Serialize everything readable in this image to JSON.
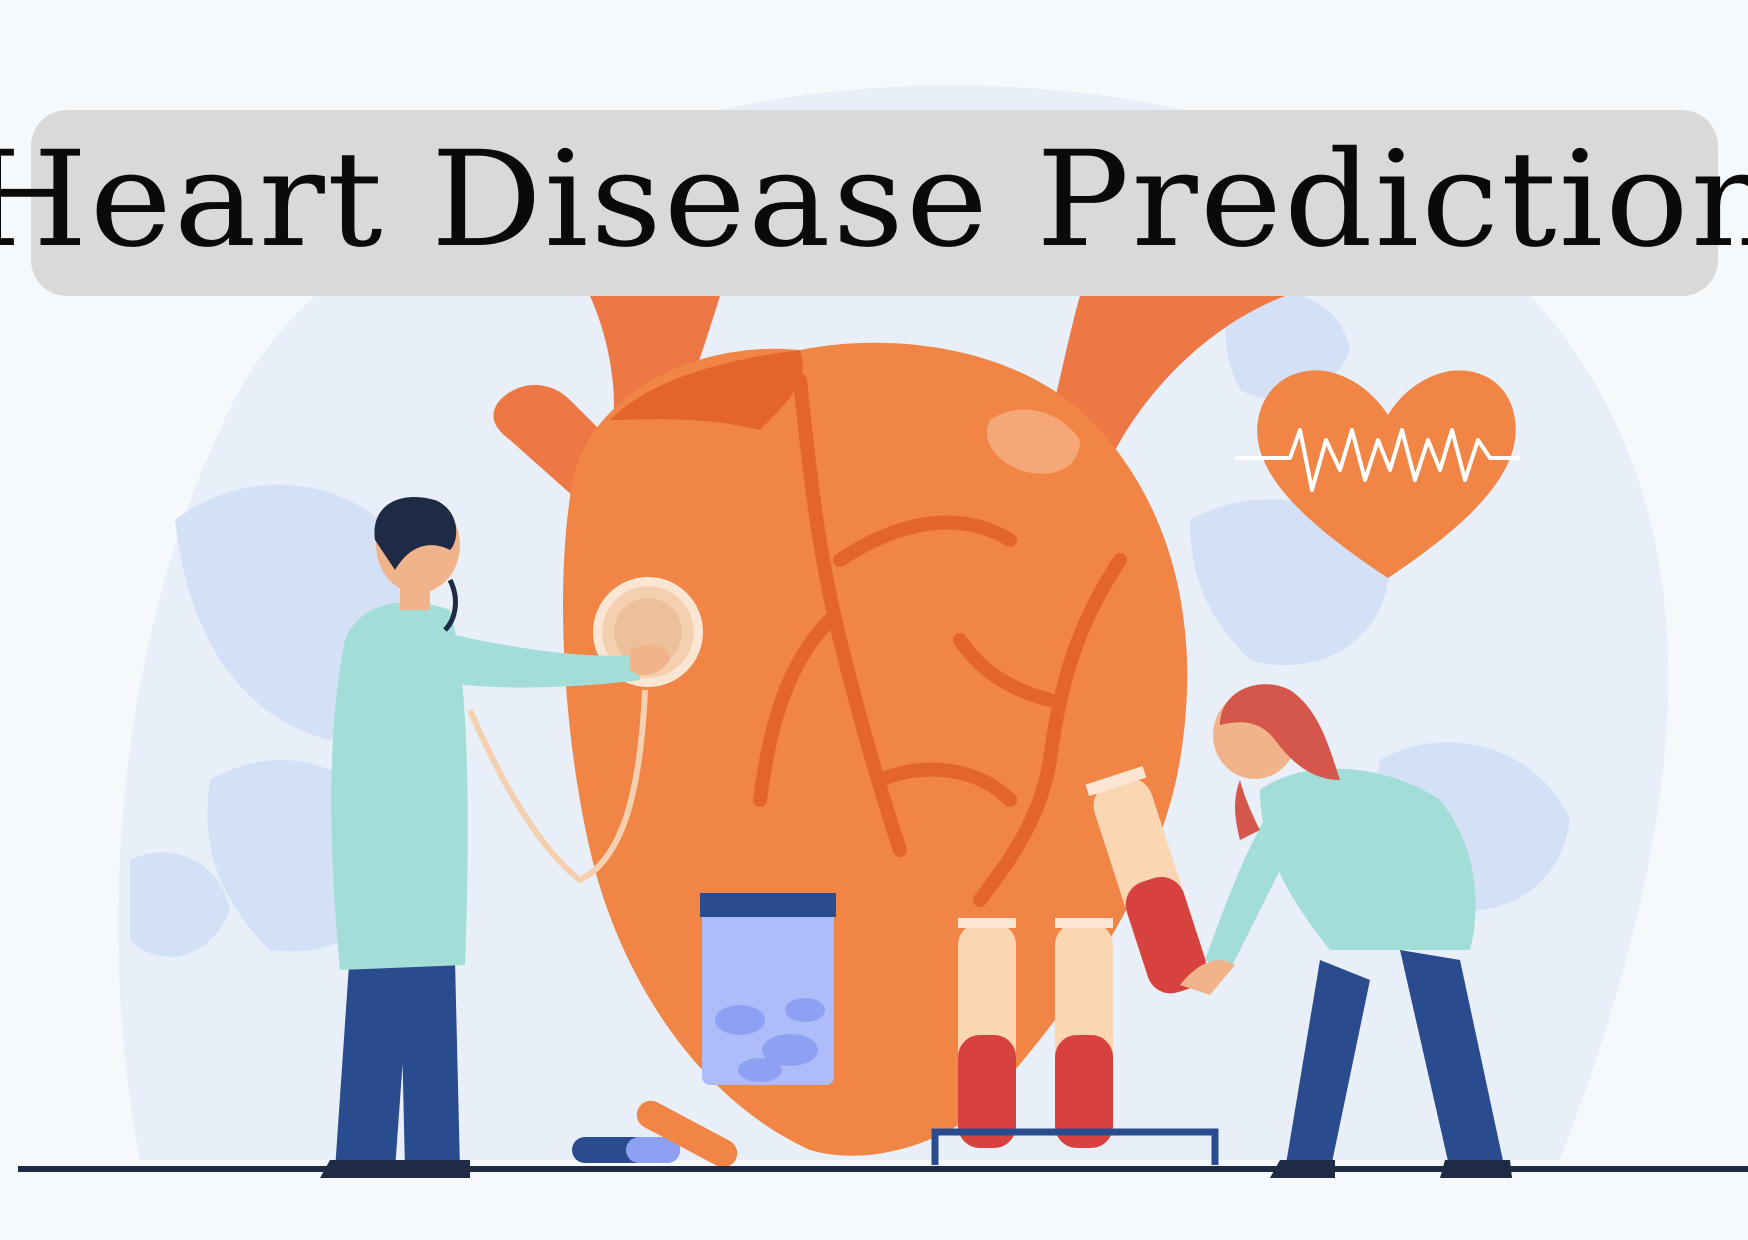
{
  "title": "Heart Disease Prediction",
  "colors": {
    "background": "#f5f9fc",
    "blob": "#e8eff8",
    "leaf": "#d3e0f5",
    "heart": "#f08546",
    "heart_dark": "#e3652d",
    "banner": "#d9d9d9",
    "coat": "#a3ddd7",
    "pants": "#2b4b8f",
    "ground": "#1f2a44"
  },
  "icons": [
    "anatomical-heart",
    "stethoscope",
    "heartbeat-heart-icon",
    "test-tube",
    "pill-jar",
    "capsule"
  ]
}
